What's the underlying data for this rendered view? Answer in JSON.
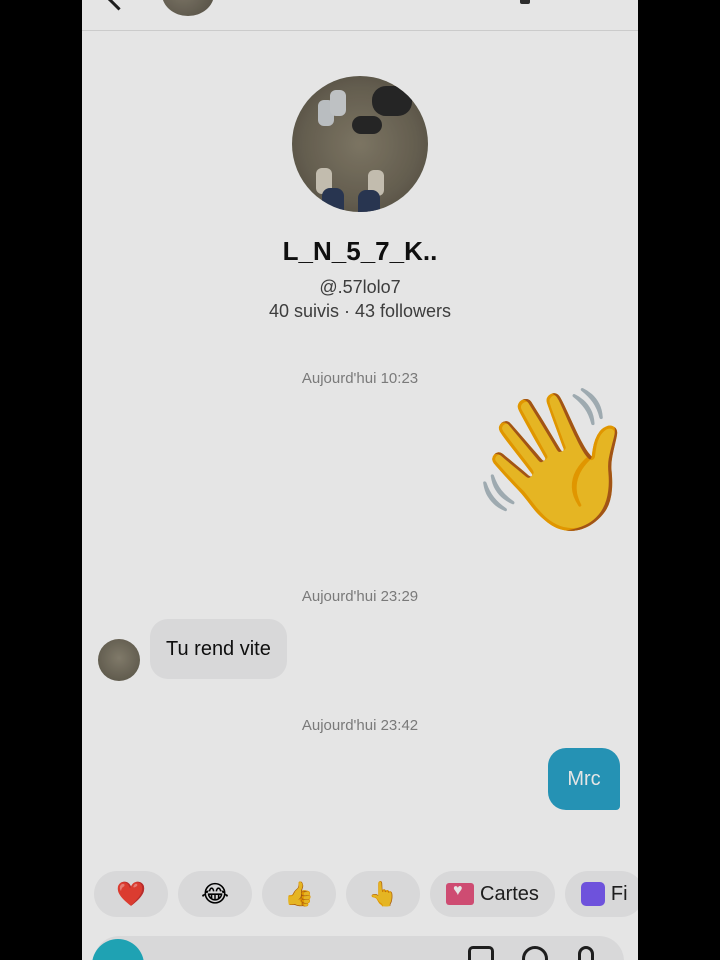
{
  "profile": {
    "name": "L_N_5_7_K..",
    "handle": "@.57lolo7",
    "stats": "40 suivis · 43 followers"
  },
  "messages": [
    {
      "timestamp": "Aujourd'hui 10:23",
      "direction": "out",
      "content": "👋"
    },
    {
      "timestamp": "Aujourd'hui 23:29",
      "direction": "in",
      "content": "Tu rend vite"
    },
    {
      "timestamp": "Aujourd'hui 23:42",
      "direction": "out",
      "content": "Mrc"
    }
  ],
  "quick_reactions": [
    "❤️",
    "😂",
    "👍",
    "👆"
  ],
  "quick_actions": {
    "cards_label": "Cartes",
    "film_label": "Fi"
  },
  "colors": {
    "sent_bubble": "#2aa3c9",
    "received_bubble": "#f1f1f2",
    "camera_button": "#23b5c8"
  },
  "icons": [
    "back-arrow-icon",
    "camera-icon",
    "image-icon",
    "emoji-icon",
    "mic-icon"
  ]
}
